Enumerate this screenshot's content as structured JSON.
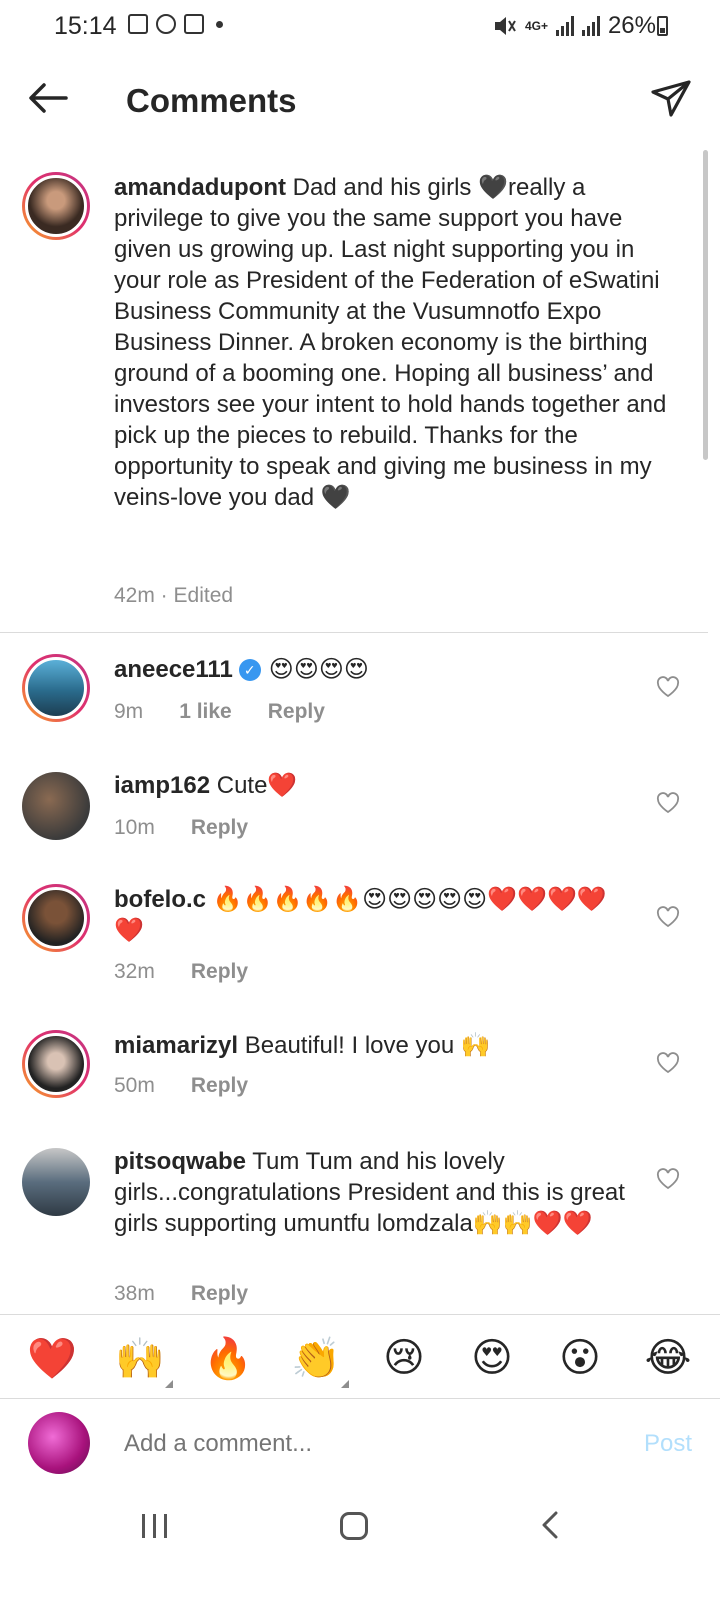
{
  "status_bar": {
    "time": "15:14",
    "network": "4G+",
    "battery": "26%"
  },
  "header": {
    "title": "Comments"
  },
  "caption": {
    "username": "amandadupont",
    "text": " Dad and his girls 🖤really a privilege to give you the same support you have given us growing up. Last night supporting you in your role as President of the Federation of eSwatini Business Community at the Vusumnotfo Expo Business Dinner. A broken economy is the birthing ground of a booming one. Hoping all business’ and investors see your intent to hold hands together and pick up the pieces to rebuild. Thanks for the opportunity to speak and giving me business in my veins-love you dad 🖤",
    "meta": "42m · Edited"
  },
  "comments": [
    {
      "username": "aneece111",
      "text": "😍😍😍😍",
      "time": "9m",
      "likes": "1 like",
      "reply": "Reply"
    },
    {
      "username": "iamp162",
      "text": " Cute❤️",
      "time": "10m",
      "reply": "Reply"
    },
    {
      "username": "bofelo.c",
      "text": " 🔥🔥🔥🔥🔥😍😍😍😍😍❤️❤️❤️❤️❤️",
      "time": "32m",
      "reply": "Reply"
    },
    {
      "username": "miamarizyl",
      "text": " Beautiful! I love you 🙌",
      "time": "50m",
      "reply": "Reply"
    },
    {
      "username": "pitsoqwabe",
      "text": " Tum Tum and his lovely girls...congratulations President and this is great girls  supporting umuntfu lomdzala🙌🙌❤️❤️",
      "time": "38m",
      "reply": "Reply"
    }
  ],
  "emoji_bar": [
    "❤️",
    "🙌",
    "🔥",
    "👏",
    "😢",
    "😍",
    "😮",
    "😂"
  ],
  "composer": {
    "placeholder": "Add a comment...",
    "post_label": "Post"
  }
}
